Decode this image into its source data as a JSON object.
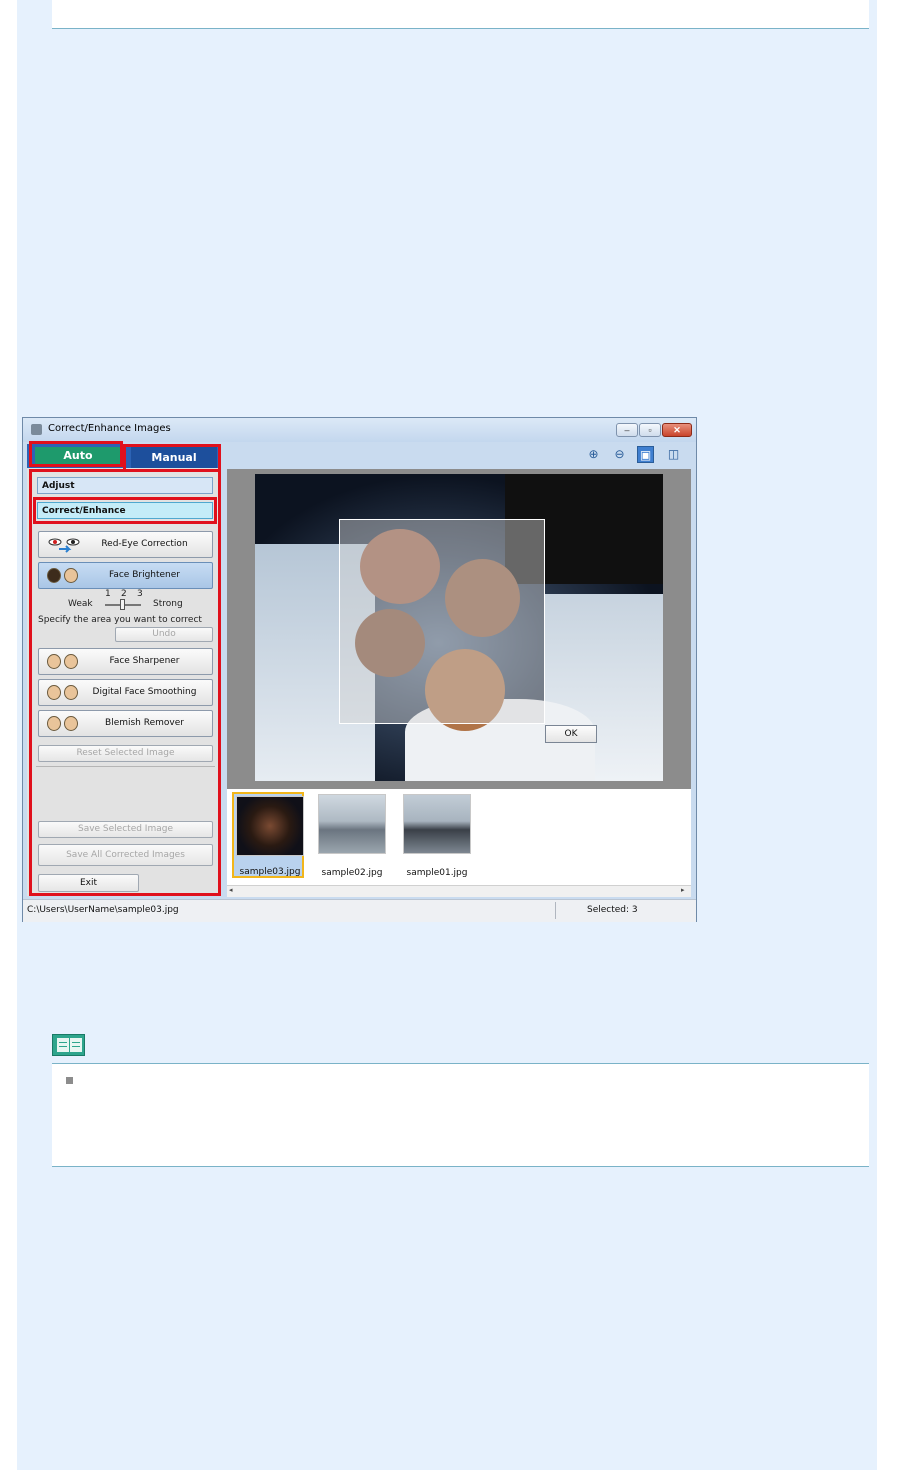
{
  "window": {
    "title": "Correct/Enhance Images",
    "minimize": "–",
    "restore": "▫",
    "close": "✕"
  },
  "tabs": {
    "auto": "Auto",
    "manual": "Manual"
  },
  "sections": {
    "adjust": "Adjust",
    "correct_enhance": "Correct/Enhance"
  },
  "tools": [
    {
      "label": "Red-Eye Correction"
    },
    {
      "label": "Face Brightener"
    },
    {
      "label": "Face Sharpener"
    },
    {
      "label": "Digital Face Smoothing"
    },
    {
      "label": "Blemish Remover"
    }
  ],
  "slider": {
    "weak": "Weak",
    "strong": "Strong",
    "tick1": "1",
    "tick2": "2",
    "tick3": "3",
    "value": 2
  },
  "hint": "Specify the area you want to correct",
  "buttons": {
    "undo": "Undo",
    "reset": "Reset Selected Image",
    "save_selected": "Save Selected Image",
    "save_all": "Save All Corrected Images",
    "exit": "Exit",
    "ok": "OK"
  },
  "toolbar_icons": [
    "zoom-in-icon",
    "zoom-out-icon",
    "whole-image-icon",
    "compare-icon"
  ],
  "thumbnails": [
    {
      "name": "sample03.jpg",
      "selected": true
    },
    {
      "name": "sample02.jpg",
      "selected": false
    },
    {
      "name": "sample01.jpg",
      "selected": false
    }
  ],
  "status": {
    "path": "C:\\Users\\UserName\\sample03.jpg",
    "selected": "Selected: 3"
  },
  "colors": {
    "highlight": "#e0101c",
    "auto_tab": "#1e9a6c",
    "manual_tab": "#1d4f9c",
    "page_bg": "#e6f1fd"
  }
}
